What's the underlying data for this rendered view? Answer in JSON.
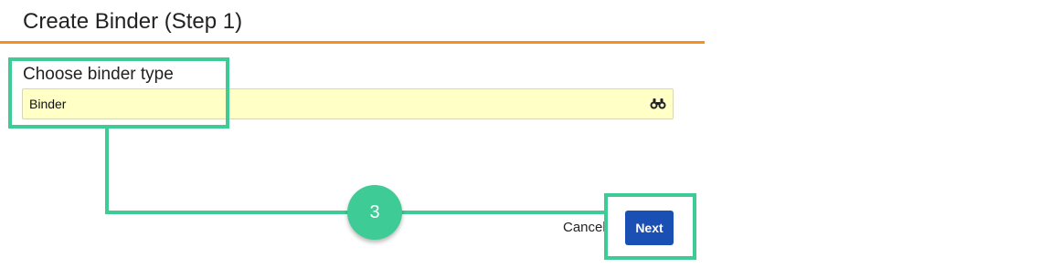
{
  "dialog": {
    "title": "Create Binder (Step 1)",
    "accent_color": "#f5921e"
  },
  "binder_type_field": {
    "label": "Choose binder type",
    "value": "Binder",
    "lookup_icon": "binoculars-icon",
    "background_color": "#ffffc6"
  },
  "actions": {
    "cancel_label": "Cancel",
    "next_label": "Next",
    "next_color": "#1a4fb3"
  },
  "annotation": {
    "step_number": "3",
    "color": "#3ecb96"
  }
}
